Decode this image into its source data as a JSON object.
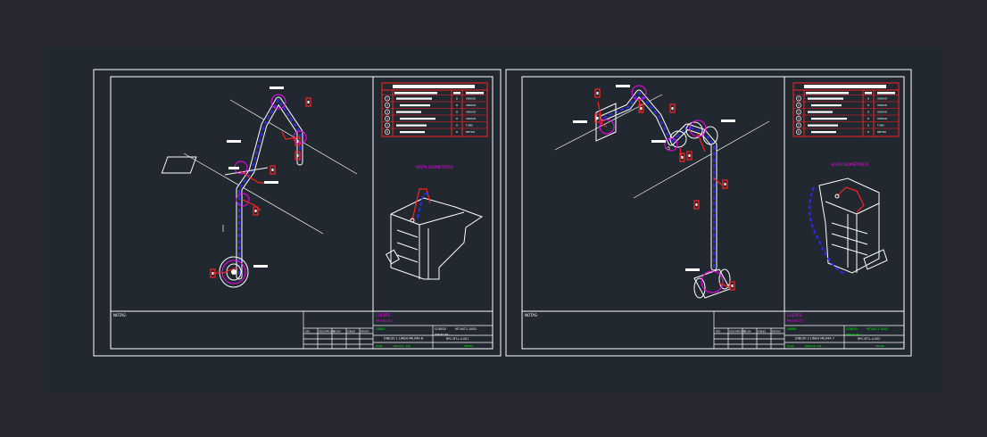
{
  "colors": {
    "background": "#2b2730",
    "paper": "#212830",
    "frame": "#ffffff",
    "pipe": "#ffffff",
    "dashed_line": "#2a2aff",
    "balloon": "#ff2020",
    "magenta_text": "#ff00ff",
    "green_text": "#00ff00",
    "table_red": "#ff2020"
  },
  "sheets": [
    {
      "notes_label": "NOTAS:",
      "view_label": "VISTA ISOMETRICA",
      "client_label": "CLIENTE",
      "project_label": "PROYECTO",
      "title_green": "LINEA",
      "drawing_title": "DIBUJO 1 LINEA MILIMA 8",
      "drawing_no_label": "DIBUJO No.",
      "drawing_no": "RPC-MT-L-4-001",
      "code_label": "CODIGO",
      "code": "MT-AUT-1-0002",
      "scale_label": "ESCALA: S/E",
      "date_label": "FECHA",
      "sheet_label": "HOJA",
      "revision_headers": [
        "REV",
        "DESCRIPCION",
        "FECHA",
        "DIBUJO",
        "REVISO"
      ],
      "material_rows": [
        {
          "no": "1",
          "qty": "8",
          "unit": "UNIDAD"
        },
        {
          "no": "2",
          "qty": "8",
          "unit": "UNIDAD"
        },
        {
          "no": "3",
          "qty": "8",
          "unit": "UNIDAD"
        },
        {
          "no": "4",
          "qty": "8",
          "unit": "UNIDAD"
        },
        {
          "no": "5",
          "qty": "8",
          "unit": "TUBO"
        },
        {
          "no": "6",
          "qty": "8",
          "unit": "METRO"
        }
      ]
    },
    {
      "notes_label": "NOTAS:",
      "view_label": "VISTA ISOMETRICA",
      "client_label": "CLIENTE",
      "project_label": "PROYECTO",
      "title_green": "LINEA",
      "drawing_title": "DIBUJO 2 LINEA MILIMA 7",
      "drawing_no_label": "DIBUJO No.",
      "drawing_no": "RPC-MT-L-4-002",
      "code_label": "CODIGO",
      "code": "MT-AUT-1-0003",
      "scale_label": "ESCALA: S/E",
      "date_label": "FECHA",
      "sheet_label": "HOJA",
      "revision_headers": [
        "REV",
        "DESCRIPCION",
        "FECHA",
        "DIBUJO",
        "REVISO"
      ],
      "material_rows": [
        {
          "no": "1",
          "qty": "8",
          "unit": "UNIDAD"
        },
        {
          "no": "2",
          "qty": "8",
          "unit": "UNIDAD"
        },
        {
          "no": "3",
          "qty": "8",
          "unit": "UNIDAD"
        },
        {
          "no": "4",
          "qty": "8",
          "unit": "UNIDAD"
        },
        {
          "no": "5",
          "qty": "8",
          "unit": "TUBO"
        },
        {
          "no": "6",
          "qty": "8",
          "unit": "METRO"
        }
      ]
    }
  ]
}
